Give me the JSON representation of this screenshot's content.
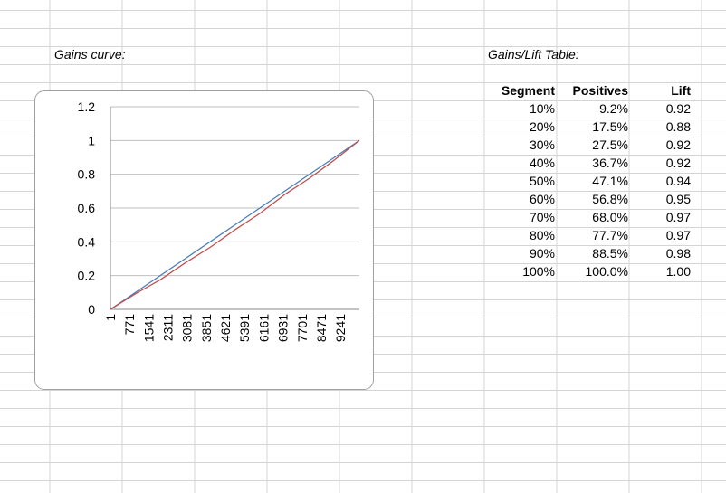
{
  "sheet": {
    "gains_curve_label": "Gains curve:",
    "table_label": "Gains/Lift Table:"
  },
  "table": {
    "headers": [
      "Segment",
      "Positives",
      "Lift"
    ],
    "rows": [
      [
        "10%",
        "9.2%",
        "0.92"
      ],
      [
        "20%",
        "17.5%",
        "0.88"
      ],
      [
        "30%",
        "27.5%",
        "0.92"
      ],
      [
        "40%",
        "36.7%",
        "0.92"
      ],
      [
        "50%",
        "47.1%",
        "0.94"
      ],
      [
        "60%",
        "56.8%",
        "0.95"
      ],
      [
        "70%",
        "68.0%",
        "0.97"
      ],
      [
        "80%",
        "77.7%",
        "0.97"
      ],
      [
        "90%",
        "88.5%",
        "0.98"
      ],
      [
        "100%",
        "100.0%",
        "1.00"
      ]
    ]
  },
  "chart_data": {
    "type": "line",
    "title": "",
    "xlabel": "",
    "ylabel": "",
    "ylim": [
      0,
      1.2
    ],
    "xlim": [
      1,
      10000
    ],
    "y_ticks": [
      "0",
      "0.2",
      "0.4",
      "0.6",
      "0.8",
      "1",
      "1.2"
    ],
    "x_ticks": [
      "1",
      "771",
      "1541",
      "2311",
      "3081",
      "3851",
      "4621",
      "5391",
      "6161",
      "6931",
      "7701",
      "8471",
      "9241"
    ],
    "grid": true,
    "legend": "none",
    "series": [
      {
        "color": "#4a7ebb",
        "x": [
          1,
          10000
        ],
        "y": [
          0,
          1.0
        ]
      },
      {
        "color": "#c0504d",
        "x": [
          1,
          1000,
          2000,
          3000,
          4000,
          5000,
          6000,
          7000,
          8000,
          9000,
          10000
        ],
        "y": [
          0,
          0.092,
          0.175,
          0.275,
          0.367,
          0.471,
          0.568,
          0.68,
          0.777,
          0.885,
          1.0
        ]
      }
    ]
  }
}
